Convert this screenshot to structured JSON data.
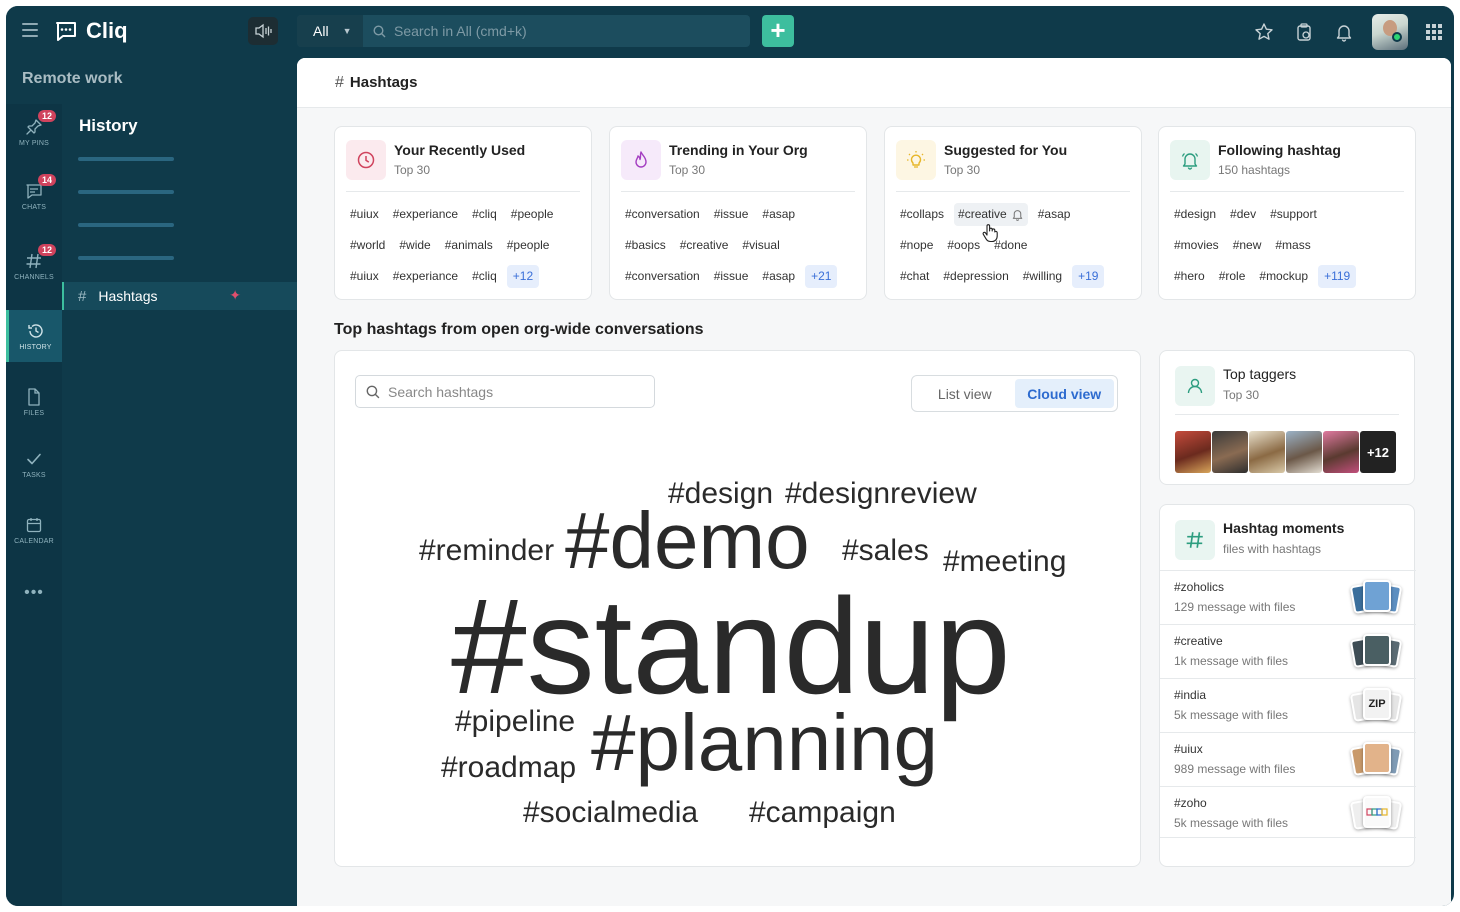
{
  "app": {
    "name": "Cliq",
    "workspace": "Remote work"
  },
  "search": {
    "scope": "All",
    "placeholder": "Search in All (cmd+k)"
  },
  "rail": [
    {
      "label": "MY PINS",
      "badge": "12",
      "icon": "pin-icon"
    },
    {
      "label": "CHATS",
      "badge": "14",
      "icon": "chat-icon"
    },
    {
      "label": "CHANNELS",
      "badge": "12",
      "icon": "hash-icon"
    },
    {
      "label": "HISTORY",
      "badge": "",
      "icon": "history-icon",
      "active": true
    },
    {
      "label": "FILES",
      "badge": "",
      "icon": "file-icon"
    },
    {
      "label": "TASKS",
      "badge": "",
      "icon": "check-icon"
    },
    {
      "label": "CALENDAR",
      "badge": "",
      "icon": "calendar-icon"
    }
  ],
  "subnav": {
    "title": "History",
    "active_item": "Hashtags"
  },
  "page": {
    "title": "Hashtags",
    "section_title": "Top hashtags from open org-wide conversations"
  },
  "categories": [
    {
      "title": "Your Recently Used",
      "sub": "Top 30",
      "icon": "clock-icon",
      "accent": "#d0435d",
      "rows": [
        [
          "#uiux",
          "#experiance",
          "#cliq",
          "#people"
        ],
        [
          "#world",
          "#wide",
          "#animals",
          "#people"
        ],
        [
          "#uiux",
          "#experiance",
          "#cliq"
        ]
      ],
      "more": "+12"
    },
    {
      "title": "Trending in Your Org",
      "sub": "Top 30",
      "icon": "flame-icon",
      "accent": "#a43ec1",
      "rows": [
        [
          "#conversation",
          "#issue",
          "#asap"
        ],
        [
          "#basics",
          "#creative",
          "#visual"
        ],
        [
          "#conversation",
          "#issue",
          "#asap"
        ]
      ],
      "more": "+21"
    },
    {
      "title": "Suggested for You",
      "sub": "Top 30",
      "icon": "bulb-icon",
      "accent": "#e7b629",
      "rows": [
        [
          "#collaps",
          "#creative",
          "#asap"
        ],
        [
          "#nope",
          "#oops",
          "#done"
        ],
        [
          "#chat",
          "#depression",
          "#willing"
        ]
      ],
      "more": "+19"
    },
    {
      "title": "Following hashtag",
      "sub": "150 hashtags",
      "icon": "bell-icon",
      "accent": "#2c9d7f",
      "rows": [
        [
          "#design",
          "#dev",
          "#support"
        ],
        [
          "#movies",
          "#new",
          "#mass"
        ],
        [
          "#hero",
          "#role",
          "#mockup"
        ]
      ],
      "more": "+119"
    }
  ],
  "cloud": {
    "search_placeholder": "Search hashtags",
    "views": [
      "List view",
      "Cloud view"
    ],
    "active_view": "Cloud view",
    "words": [
      {
        "text": "#design"
      },
      {
        "text": "#designreview"
      },
      {
        "text": "#reminder"
      },
      {
        "text": "#demo"
      },
      {
        "text": "#sales"
      },
      {
        "text": "#meeting"
      },
      {
        "text": "#standup"
      },
      {
        "text": "#pipeline"
      },
      {
        "text": "#roadmap"
      },
      {
        "text": "#planning"
      },
      {
        "text": "#socialmedia"
      },
      {
        "text": "#campaign"
      }
    ]
  },
  "top_taggers": {
    "title": "Top taggers",
    "sub": "Top 30",
    "more": "+12"
  },
  "moments": {
    "title": "Hashtag moments",
    "sub": "files with hashtags",
    "items": [
      {
        "name": "#zoholics",
        "count": "129 message with files"
      },
      {
        "name": "#creative",
        "count": "1k message with files"
      },
      {
        "name": "#india",
        "count": "5k message with files",
        "badge": "ZIP"
      },
      {
        "name": "#uiux",
        "count": "989 message with files"
      },
      {
        "name": "#zoho",
        "count": "5k message with files"
      }
    ]
  },
  "colors": {
    "brand": "#0f3a4a",
    "accent": "#3dbe9e",
    "link": "#2d6bcf"
  }
}
